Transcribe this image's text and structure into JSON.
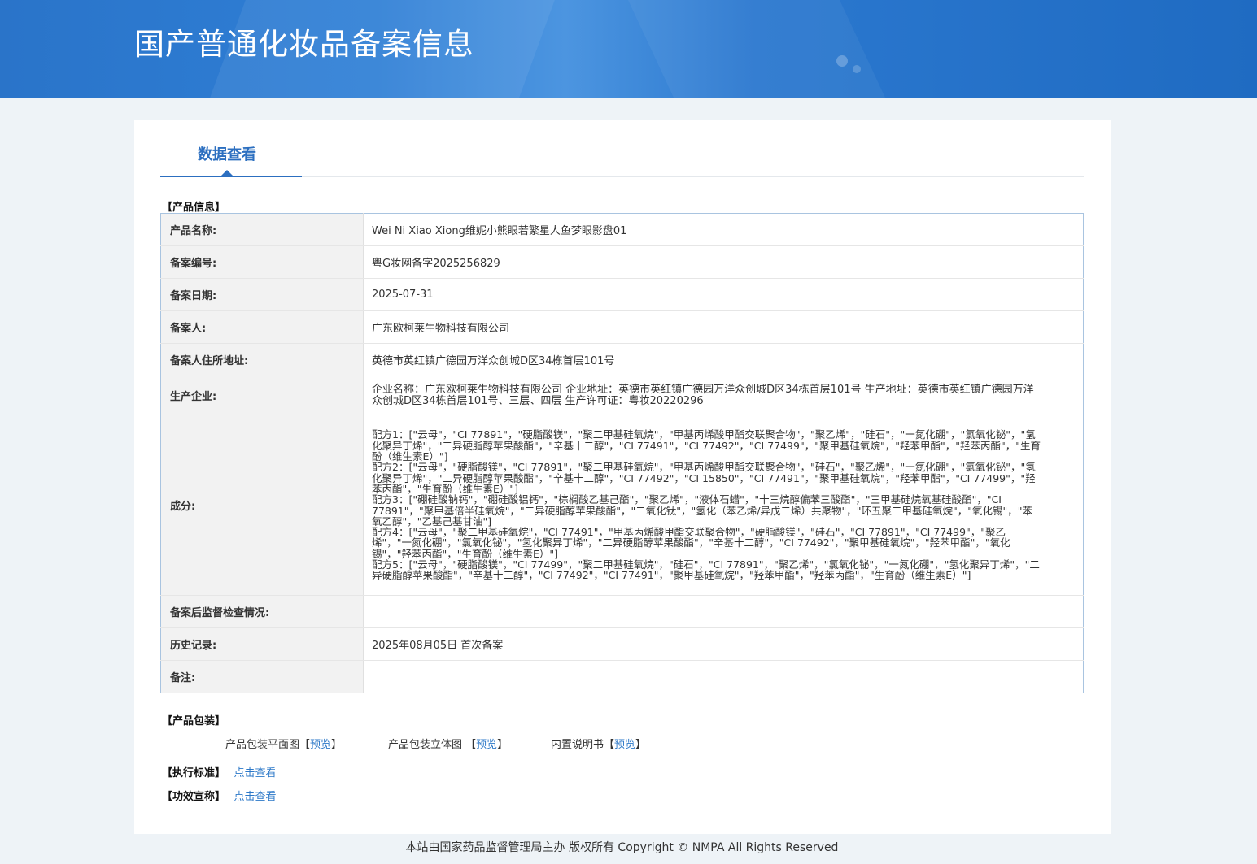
{
  "page": {
    "title": "国产普通化妆品备案信息",
    "tab": "数据查看"
  },
  "product_section": {
    "title": "【产品信息】",
    "rows": [
      {
        "label": "产品名称:",
        "value": "Wei Ni Xiao Xiong维妮小熊眼若繁星人鱼梦眼影盘01"
      },
      {
        "label": "备案编号:",
        "value": "粤G妆网备字2025256829"
      },
      {
        "label": "备案日期:",
        "value": "2025-07-31"
      },
      {
        "label": "备案人:",
        "value": "广东欧柯莱生物科技有限公司"
      },
      {
        "label": "备案人住所地址:",
        "value": "英德市英红镇广德园万洋众创城D区34栋首层101号"
      },
      {
        "label": "生产企业:",
        "value": "企业名称：广东欧柯莱生物科技有限公司 企业地址：英德市英红镇广德园万洋众创城D区34栋首层101号 生产地址：英德市英红镇广德园万洋众创城D区34栋首层101号、三层、四层 生产许可证：粤妆20220296"
      },
      {
        "label": "成分:",
        "value": ""
      },
      {
        "label": "备案后监督检查情况:",
        "value": ""
      },
      {
        "label": "历史记录:",
        "value": "2025年08月05日 首次备案"
      },
      {
        "label": "备注:",
        "value": ""
      }
    ],
    "formulas": [
      "配方1：[\"云母\"，\"CI 77891\"，\"硬脂酸镁\"，\"聚二甲基硅氧烷\"，\"甲基丙烯酸甲酯交联聚合物\"，\"聚乙烯\"，\"硅石\"，\"一氮化硼\"，\"氯氧化铋\"，\"氢化聚异丁烯\"，\"二异硬脂醇苹果酸酯\"，\"辛基十二醇\"，\"CI 77491\"，\"CI 77492\"，\"CI 77499\"，\"聚甲基硅氧烷\"，\"羟苯甲酯\"，\"羟苯丙酯\"，\"生育酚（维生素E）\"]",
      "配方2：[\"云母\"，\"硬脂酸镁\"，\"CI 77891\"，\"聚二甲基硅氧烷\"，\"甲基丙烯酸甲酯交联聚合物\"，\"硅石\"，\"聚乙烯\"，\"一氮化硼\"，\"氯氧化铋\"，\"氢化聚异丁烯\"，\"二异硬脂醇苹果酸酯\"，\"辛基十二醇\"，\"CI 77492\"，\"CI 15850\"，\"CI 77491\"，\"聚甲基硅氧烷\"，\"羟苯甲酯\"，\"CI 77499\"，\"羟苯丙酯\"，\"生育酚（维生素E）\"]",
      "配方3：[\"硼硅酸钠钙\"，\"硼硅酸铝钙\"，\"棕榈酸乙基己酯\"，\"聚乙烯\"，\"液体石蜡\"，\"十三烷醇偏苯三酸酯\"，\"三甲基硅烷氧基硅酸酯\"，\"CI 77891\"，\"聚甲基倍半硅氧烷\"，\"二异硬脂醇苹果酸酯\"，\"二氧化钛\"，\"氢化（苯乙烯/异戊二烯）共聚物\"，\"环五聚二甲基硅氧烷\"，\"氧化锡\"，\"苯氧乙醇\"，\"乙基己基甘油\"]",
      "配方4：[\"云母\"，\"聚二甲基硅氧烷\"，\"CI 77491\"，\"甲基丙烯酸甲酯交联聚合物\"，\"硬脂酸镁\"，\"硅石\"，\"CI 77891\"，\"CI 77499\"，\"聚乙烯\"，\"一氮化硼\"，\"氯氧化铋\"，\"氢化聚异丁烯\"，\"二异硬脂醇苹果酸酯\"，\"辛基十二醇\"，\"CI 77492\"，\"聚甲基硅氧烷\"，\"羟苯甲酯\"，\"氧化锡\"，\"羟苯丙酯\"，\"生育酚（维生素E）\"]",
      "配方5：[\"云母\"，\"硬脂酸镁\"，\"CI 77499\"，\"聚二甲基硅氧烷\"，\"硅石\"，\"CI 77891\"，\"聚乙烯\"，\"氯氧化铋\"，\"一氮化硼\"，\"氢化聚异丁烯\"，\"二异硬脂醇苹果酸酯\"，\"辛基十二醇\"，\"CI 77492\"，\"CI 77491\"，\"聚甲基硅氧烷\"，\"羟苯甲酯\"，\"羟苯丙酯\"，\"生育酚（维生素E）\"]"
    ]
  },
  "packaging": {
    "title": "【产品包装】",
    "items": [
      {
        "label": "产品包装平面图",
        "open": "【",
        "link": "预览",
        "close": "】"
      },
      {
        "label": "产品包装立体图 ",
        "open": "【",
        "link": "预览",
        "close": "】"
      },
      {
        "label": "内置说明书",
        "open": "【",
        "link": "预览",
        "close": "】"
      }
    ]
  },
  "standard": {
    "title": "【执行标准】",
    "link": "点击查看"
  },
  "efficacy": {
    "title": "【功效宣称】",
    "link": "点击查看"
  },
  "footer": {
    "text": "本站由国家药品监督管理局主办 版权所有 Copyright © NMPA All Rights Reserved"
  }
}
